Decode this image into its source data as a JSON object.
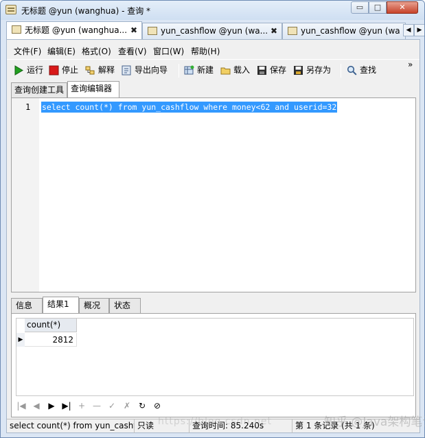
{
  "window": {
    "title": "无标题 @yun (wanghua) - 查询 *",
    "min_label": "▭",
    "max_label": "□",
    "close_label": "✕"
  },
  "doc_tabs": [
    {
      "label": "无标题 @yun (wanghua...",
      "close": "✖"
    },
    {
      "label": "yun_cashflow @yun (wa...",
      "close": "✖"
    },
    {
      "label": "yun_cashflow @yun (wa"
    }
  ],
  "tab_scroll": {
    "left": "◀",
    "right": "▶"
  },
  "menu": [
    "文件(F)",
    "编辑(E)",
    "格式(O)",
    "查看(V)",
    "窗口(W)",
    "帮助(H)"
  ],
  "toolbar": {
    "run": "运行",
    "stop": "停止",
    "explain": "解释",
    "export": "导出向导",
    "new": "新建",
    "load": "载入",
    "save": "保存",
    "save_as": "另存为",
    "find": "查找",
    "more": "»"
  },
  "sub_tabs": [
    "查询创建工具",
    "查询编辑器"
  ],
  "editor": {
    "line_number": "1",
    "sql": "select count(*) from yun_cashflow where money<62 and userid=32"
  },
  "result_tabs": [
    "信息",
    "结果1",
    "概况",
    "状态"
  ],
  "result": {
    "column": "count(*)",
    "row_marker": "▶",
    "value": "2812"
  },
  "navigator": [
    "|◀",
    "◀",
    "▶",
    "▶|",
    "+",
    "—",
    "✓",
    "✗",
    "↻",
    "⊘"
  ],
  "status": {
    "sql": "select count(*) from yun_cashflo",
    "readonly": "只读",
    "query_time": "查询时间: 85.240s",
    "record": "第 1 条记录 (共 1 条)"
  },
  "watermark": {
    "url": "https://blog.csdn.net",
    "brand": "知乎 @Java架构笔记"
  },
  "colors": {
    "selection": "#3399ff",
    "run_icon": "#22a020",
    "stop_icon": "#d81818"
  }
}
